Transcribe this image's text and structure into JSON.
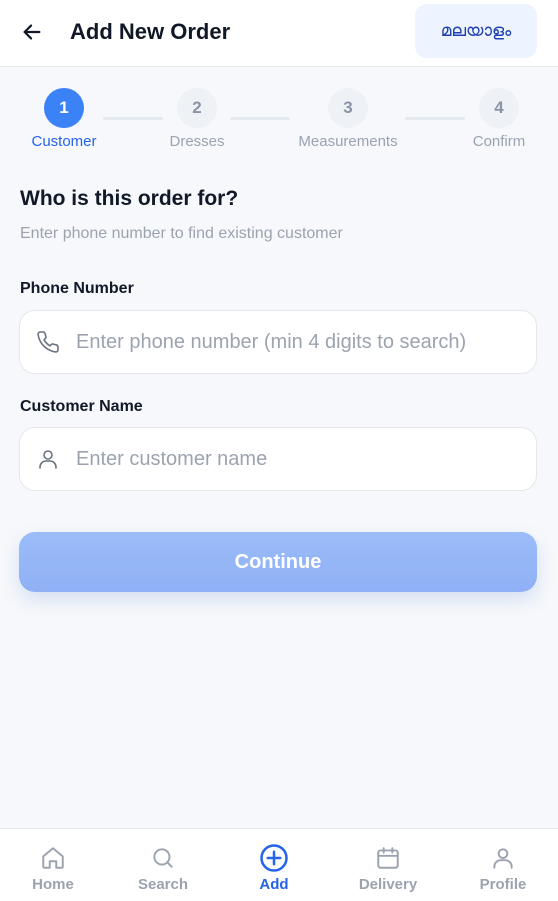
{
  "header": {
    "title": "Add New Order",
    "back_icon": "arrow-left-icon",
    "language_button": "മലയാളം"
  },
  "stepper": {
    "steps": [
      {
        "number": "1",
        "label": "Customer",
        "active": true
      },
      {
        "number": "2",
        "label": "Dresses",
        "active": false
      },
      {
        "number": "3",
        "label": "Measurements",
        "active": false
      },
      {
        "number": "4",
        "label": "Confirm",
        "active": false
      }
    ]
  },
  "form": {
    "title": "Who is this order for?",
    "subtitle": "Enter phone number to find existing customer",
    "phone": {
      "label": "Phone Number",
      "placeholder": "Enter phone number (min 4 digits to search)",
      "value": "",
      "icon": "phone-icon"
    },
    "name": {
      "label": "Customer Name",
      "placeholder": "Enter customer name",
      "value": "",
      "icon": "user-icon"
    },
    "continue_label": "Continue"
  },
  "bottom_nav": {
    "items": [
      {
        "label": "Home",
        "icon": "home-icon",
        "active": false
      },
      {
        "label": "Search",
        "icon": "search-icon",
        "active": false
      },
      {
        "label": "Add",
        "icon": "plus-circle-icon",
        "active": true
      },
      {
        "label": "Delivery",
        "icon": "calendar-icon",
        "active": false
      },
      {
        "label": "Profile",
        "icon": "user-icon",
        "active": false
      }
    ]
  },
  "colors": {
    "accent": "#3b82f6",
    "accent_text": "#2563eb",
    "background": "#f6f8fb",
    "muted_text": "#9ca3af",
    "button_disabled": "#93b4f6"
  }
}
